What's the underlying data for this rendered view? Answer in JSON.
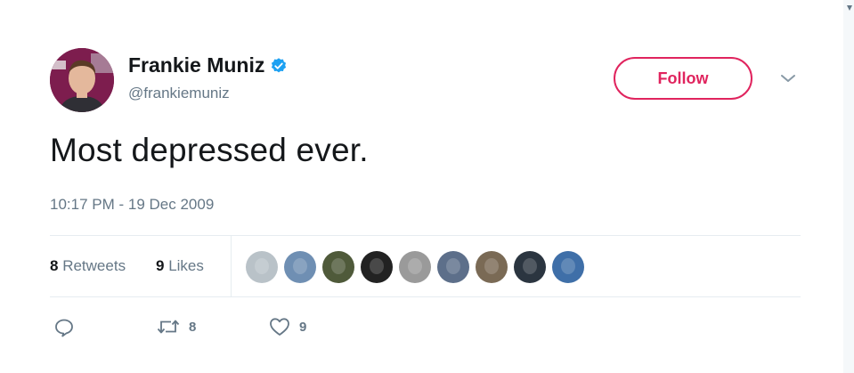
{
  "user": {
    "display_name": "Frankie Muniz",
    "handle": "@frankiemuniz",
    "verified": true
  },
  "follow_label": "Follow",
  "tweet": {
    "text": "Most depressed ever.",
    "timestamp": "10:17 PM - 19 Dec 2009"
  },
  "stats": {
    "retweets_count": "8",
    "retweets_label": "Retweets",
    "likes_count": "9",
    "likes_label": "Likes"
  },
  "liker_avatars": [
    {
      "name": "liker-avatar-1",
      "color": "#b9c2c8"
    },
    {
      "name": "liker-avatar-2",
      "color": "#6f8fb3"
    },
    {
      "name": "liker-avatar-3",
      "color": "#4f5a3a"
    },
    {
      "name": "liker-avatar-4",
      "color": "#222222"
    },
    {
      "name": "liker-avatar-5",
      "color": "#9a9a9a"
    },
    {
      "name": "liker-avatar-6",
      "color": "#5d6f8a"
    },
    {
      "name": "liker-avatar-7",
      "color": "#7a6a55"
    },
    {
      "name": "liker-avatar-8",
      "color": "#2b3540"
    },
    {
      "name": "liker-avatar-9",
      "color": "#3f6fa8"
    }
  ],
  "actions": {
    "reply_icon": "reply-icon",
    "retweet_count": "8",
    "like_count": "9"
  },
  "colors": {
    "follow_accent": "#e0245e",
    "verified_blue": "#1da1f2",
    "secondary_text": "#657786"
  }
}
